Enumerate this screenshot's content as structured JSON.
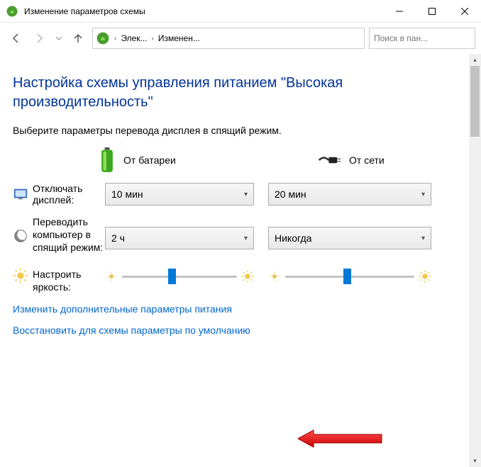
{
  "title": "Изменение параметров схемы",
  "breadcrumb": {
    "seg1": "Элек...",
    "seg2": "Изменен..."
  },
  "search": {
    "placeholder": "Поиск в пан..."
  },
  "heading": "Настройка схемы управления питанием \"Высокая производительность\"",
  "instruction": "Выберите параметры перевода дисплея в спящий режим.",
  "columns": {
    "battery": "От батареи",
    "ac": "От сети"
  },
  "rows": {
    "display_off": {
      "label": "Отключать дисплей:",
      "battery": "10 мин",
      "ac": "20 мин"
    },
    "sleep": {
      "label": "Переводить компьютер в спящий режим:",
      "battery": "2 ч",
      "ac": "Никогда"
    },
    "brightness": {
      "label": "Настроить яркость:",
      "battery_pct": 40,
      "ac_pct": 45
    }
  },
  "links": {
    "advanced": "Изменить дополнительные параметры питания",
    "restore": "Восстановить для схемы параметры по умолчанию"
  }
}
